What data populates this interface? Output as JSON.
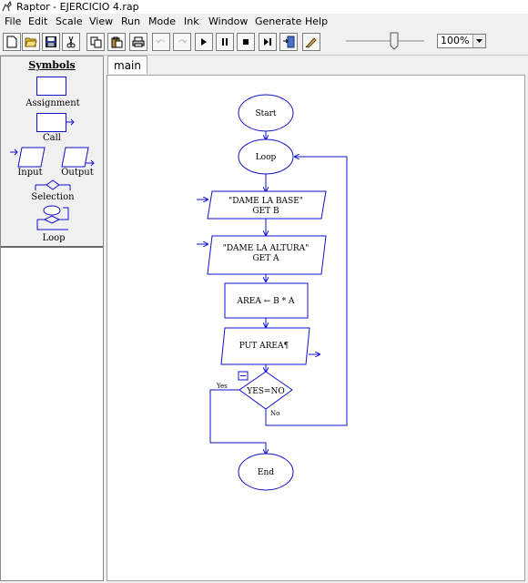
{
  "window": {
    "title": "Raptor - EJERCICIO 4.rap"
  },
  "menu": [
    "File",
    "Edit",
    "Scale",
    "View",
    "Run",
    "Mode",
    "Ink",
    "Window",
    "Generate",
    "Help"
  ],
  "zoom": {
    "value": "100%"
  },
  "symbols": {
    "heading": "Symbols",
    "assignment": "Assignment",
    "call": "Call",
    "input": "Input",
    "output": "Output",
    "selection": "Selection",
    "loop": "Loop"
  },
  "tabs": [
    "main"
  ],
  "flowchart": {
    "start": "Start",
    "loop": "Loop",
    "input1_prompt": "\"DAME LA BASE\"",
    "input1_get": "GET B",
    "input2_prompt": "\"DAME LA ALTURA\"",
    "input2_get": "GET A",
    "assign": "AREA ← B * A",
    "output": "PUT AREA¶",
    "condition": "YES=NO",
    "yes_label": "Yes",
    "no_label": "No",
    "end": "End"
  }
}
